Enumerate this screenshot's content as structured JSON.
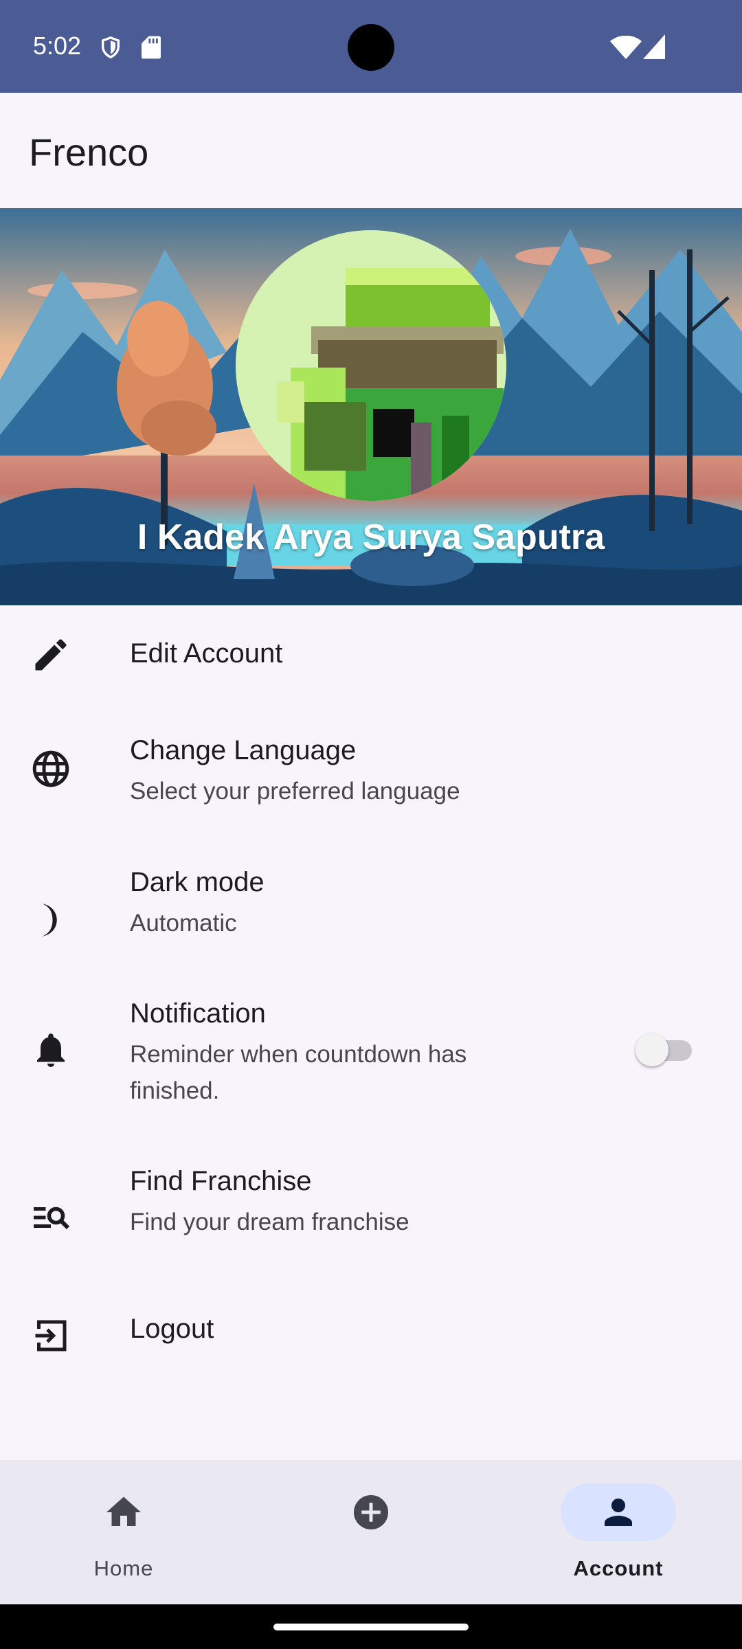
{
  "status_bar": {
    "time": "5:02"
  },
  "app": {
    "title": "Frenco"
  },
  "profile": {
    "name": "I Kadek Arya Surya Saputra"
  },
  "menu": {
    "edit_account": {
      "title": "Edit Account",
      "icon": "pencil-icon"
    },
    "change_language": {
      "title": "Change Language",
      "subtitle": "Select your preferred language",
      "icon": "globe-icon"
    },
    "dark_mode": {
      "title": "Dark mode",
      "subtitle": "Automatic",
      "icon": "moon-icon"
    },
    "notification": {
      "title": "Notification",
      "subtitle": "Reminder when countdown has finished.",
      "icon": "bell-icon",
      "enabled": false
    },
    "find_franchise": {
      "title": "Find Franchise",
      "subtitle": "Find your dream franchise",
      "icon": "list-search-icon"
    },
    "logout": {
      "title": "Logout",
      "icon": "logout-icon"
    }
  },
  "bottom_nav": {
    "home": {
      "label": "Home",
      "icon": "home-icon",
      "active": false
    },
    "add": {
      "label": "",
      "icon": "add-circle-icon",
      "active": false
    },
    "account": {
      "label": "Account",
      "icon": "person-icon",
      "active": true
    }
  },
  "colors": {
    "status_bar": "#4a5c93",
    "nav_active_pill": "#d9e2ff",
    "background": "#f7f5fb"
  }
}
